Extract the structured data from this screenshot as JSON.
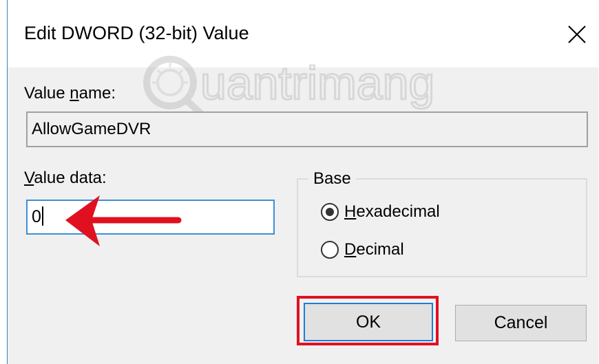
{
  "window": {
    "title": "Edit DWORD (32-bit) Value",
    "close_icon": "close-icon"
  },
  "value_name": {
    "label_pre": "Value ",
    "label_accel": "n",
    "label_post": "ame:",
    "value": "AllowGameDVR"
  },
  "value_data": {
    "label_accel": "V",
    "label_post": "alue data:",
    "value": "0"
  },
  "base": {
    "legend": "Base",
    "options": [
      {
        "accel": "H",
        "rest": "exadecimal",
        "selected": true
      },
      {
        "accel": "D",
        "rest": "ecimal",
        "selected": false
      }
    ]
  },
  "buttons": {
    "ok": "OK",
    "cancel": "Cancel"
  },
  "watermark": {
    "text": "uantrimang"
  },
  "colors": {
    "annotation_red": "#e01020",
    "focus_blue": "#1a7ed4"
  }
}
